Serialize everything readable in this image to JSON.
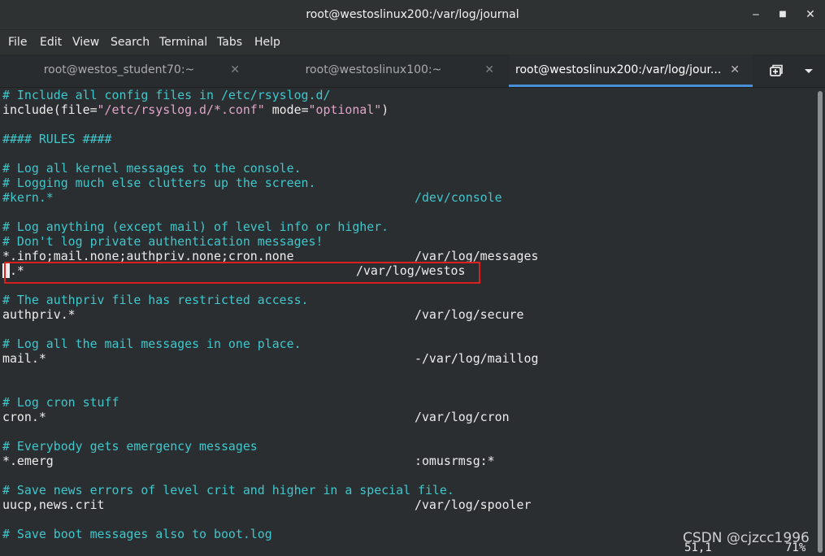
{
  "window": {
    "title": "root@westoslinux200:/var/log/journal",
    "minimize_glyph": "‒",
    "maximize_glyph": "■",
    "close_glyph": "✕"
  },
  "menu": [
    "File",
    "Edit",
    "View",
    "Search",
    "Terminal",
    "Tabs",
    "Help"
  ],
  "tabs": [
    {
      "label": "root@westos_student70:~",
      "close": "✕",
      "active": false
    },
    {
      "label": "root@westoslinux100:~",
      "close": "✕",
      "active": false
    },
    {
      "label": "root@westoslinux200:/var/log/jour...",
      "close": "✕",
      "active": true
    }
  ],
  "tab_controls": {
    "new_tab_icon": "new-tab-icon",
    "menu_icon": "chevron-down-icon"
  },
  "terminal": {
    "lines": [
      {
        "comment": "# Include all config files in /etc/rsyslog.d/"
      },
      {
        "include_pre": "include(file=",
        "include_str1": "\"/etc/rsyslog.d/*.conf\"",
        "include_mid": " mode=",
        "include_str2": "\"optional\"",
        "include_post": ")"
      },
      {
        "comment": "#### RULES ####"
      },
      {
        "comment": "# Log all kernel messages to the console."
      },
      {
        "comment": "# Logging much else clutters up the screen."
      },
      {
        "sel": "#kern.*",
        "dest": "/dev/console"
      },
      {
        "comment": "# Log anything (except mail) of level info or higher."
      },
      {
        "comment": "# Don't log private authentication messages!"
      },
      {
        "sel": "*.info;mail.none;authpriv.none;cron.none",
        "dest": "/var/log/messages"
      },
      {
        "sel": "*.*",
        "dest": "/var/log/westos"
      },
      {
        "comment": "# The authpriv file has restricted access."
      },
      {
        "sel": "authpriv.*",
        "dest": "/var/log/secure"
      },
      {
        "comment": "# Log all the mail messages in one place."
      },
      {
        "sel": "mail.*",
        "dest": "-/var/log/maillog"
      },
      {
        "comment": "# Log cron stuff"
      },
      {
        "sel": "cron.*",
        "dest": "/var/log/cron"
      },
      {
        "comment": "# Everybody gets emergency messages"
      },
      {
        "sel": "*.emerg",
        "dest": ":omusrmsg:*"
      },
      {
        "comment": "# Save news errors of level crit and higher in a special file."
      },
      {
        "sel": "uucp,news.crit",
        "dest": "/var/log/spooler"
      },
      {
        "comment": "# Save boot messages also to boot.log"
      }
    ],
    "cursor_position": "51,1",
    "scroll_percent": "71%"
  },
  "watermark": "CSDN @cjzcc1996",
  "colors": {
    "comment": "#3fc7cc",
    "string": "#e0a6c8",
    "highlight_box": "#d9221e",
    "active_tab_underline": "#4a90d9"
  }
}
